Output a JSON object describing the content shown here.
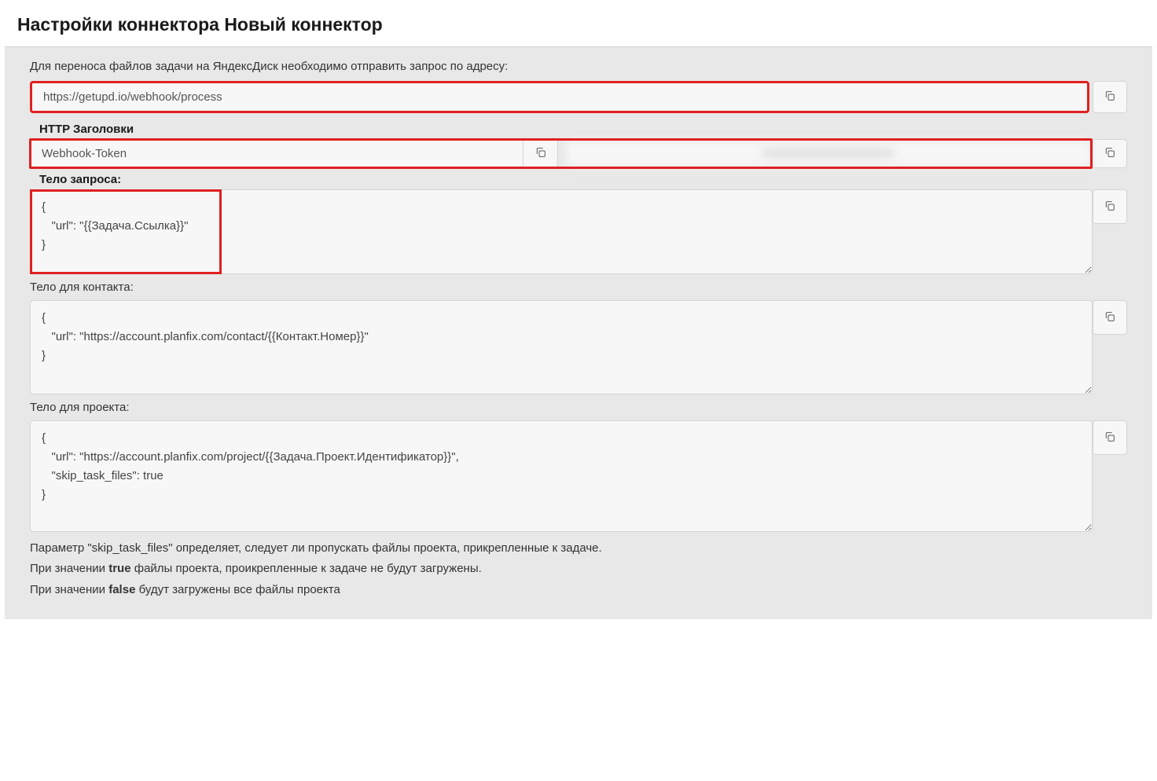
{
  "header": {
    "title": "Настройки коннектора Новый коннектор"
  },
  "intro": "Для переноса файлов задачи на ЯндексДиск необходимо отправить запрос по адресу:",
  "url_field": "https://getupd.io/webhook/process",
  "http_headers_label": "HTTP Заголовки",
  "header_name": "Webhook-Token",
  "header_value": "••••••••••••••••••••••••••••••••",
  "request_body_label": "Тело запроса:",
  "request_body_value": "{\n   \"url\": \"{{Задача.Ссылка}}\"\n}",
  "contact_body_label": "Тело для контакта:",
  "contact_body_value": "{\n   \"url\": \"https://account.planfix.com/contact/{{Контакт.Номер}}\"\n}",
  "project_body_label": "Тело для проекта:",
  "project_body_value": "{\n   \"url\": \"https://account.planfix.com/project/{{Задача.Проект.Идентификатор}}\",\n   \"skip_task_files\": true\n}",
  "footer": {
    "line1": "Параметр \"skip_task_files\" определяет, следует ли пропускать файлы проекта, прикрепленные к задаче.",
    "line2a": "При значении ",
    "line2b": "true",
    "line2c": " файлы проекта, проикрепленные к задаче не будут загружены.",
    "line3a": "При значении ",
    "line3b": "false",
    "line3c": " будут загружены все файлы проекта"
  }
}
